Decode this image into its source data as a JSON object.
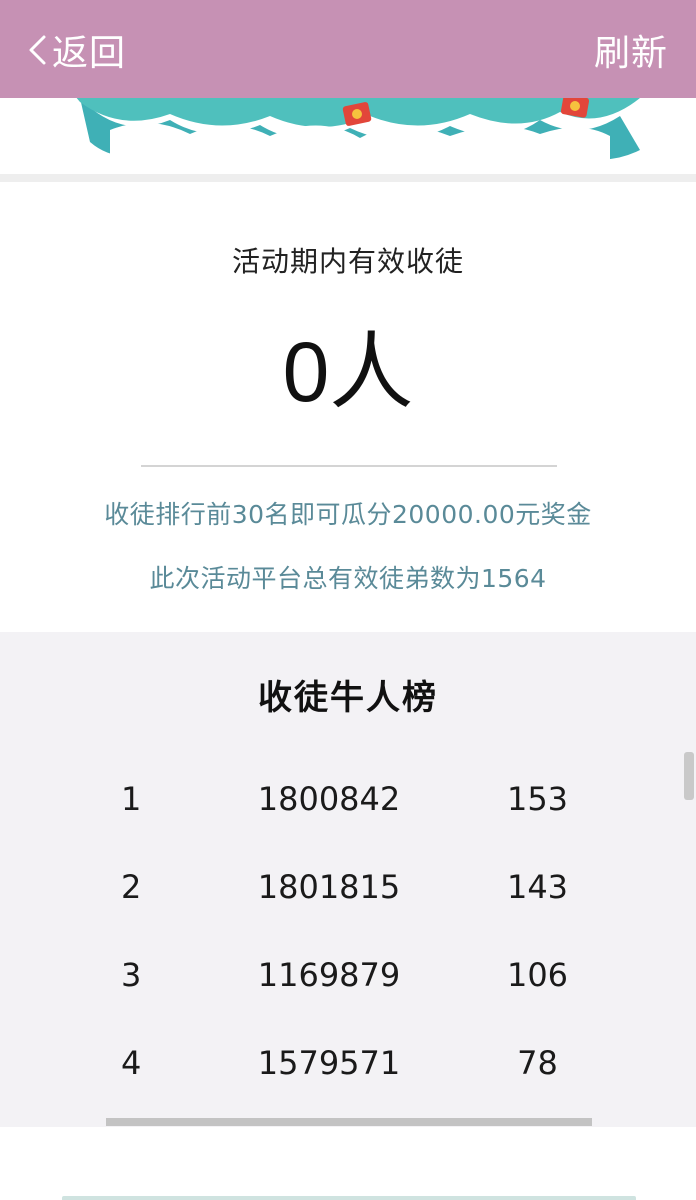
{
  "header": {
    "back_label": "返回",
    "refresh_label": "刷新",
    "background_color": "#c691b4"
  },
  "stats": {
    "title": "活动期内有效收徒",
    "count_value": "0",
    "count_unit": "人",
    "note_prize": "收徒排行前30名即可瓜分20000.00元奖金",
    "note_total": "此次活动平台总有效徒弟数为1564",
    "note_color": "#5a8a98"
  },
  "ranking": {
    "title": "收徒牛人榜",
    "rows": [
      {
        "rank": "1",
        "user_id": "1800842",
        "count": "153"
      },
      {
        "rank": "2",
        "user_id": "1801815",
        "count": "143"
      },
      {
        "rank": "3",
        "user_id": "1169879",
        "count": "106"
      },
      {
        "rank": "4",
        "user_id": "1579571",
        "count": "78"
      }
    ]
  },
  "icons": {
    "back": "chevron-left-icon",
    "decor": "red-envelope-icon"
  }
}
